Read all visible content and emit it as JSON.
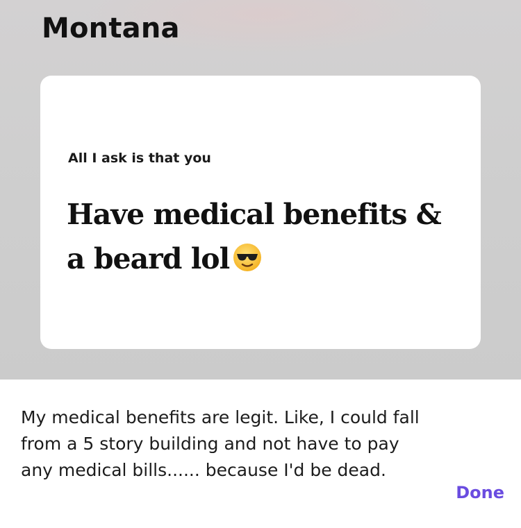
{
  "profile": {
    "name": "Montana"
  },
  "prompt": {
    "label": "All I ask is that you",
    "answer": "Have medical benefits & a beard lol",
    "emoji_icon": "smiling-face-with-sunglasses"
  },
  "comment": {
    "text": "My medical benefits are legit. Like, I could fall from a 5 story building and not have to pay any medical bills...... because I'd be dead."
  },
  "actions": {
    "done_label": "Done"
  },
  "colors": {
    "accent": "#6a4ce0",
    "backdrop": "#cfcfcf"
  }
}
